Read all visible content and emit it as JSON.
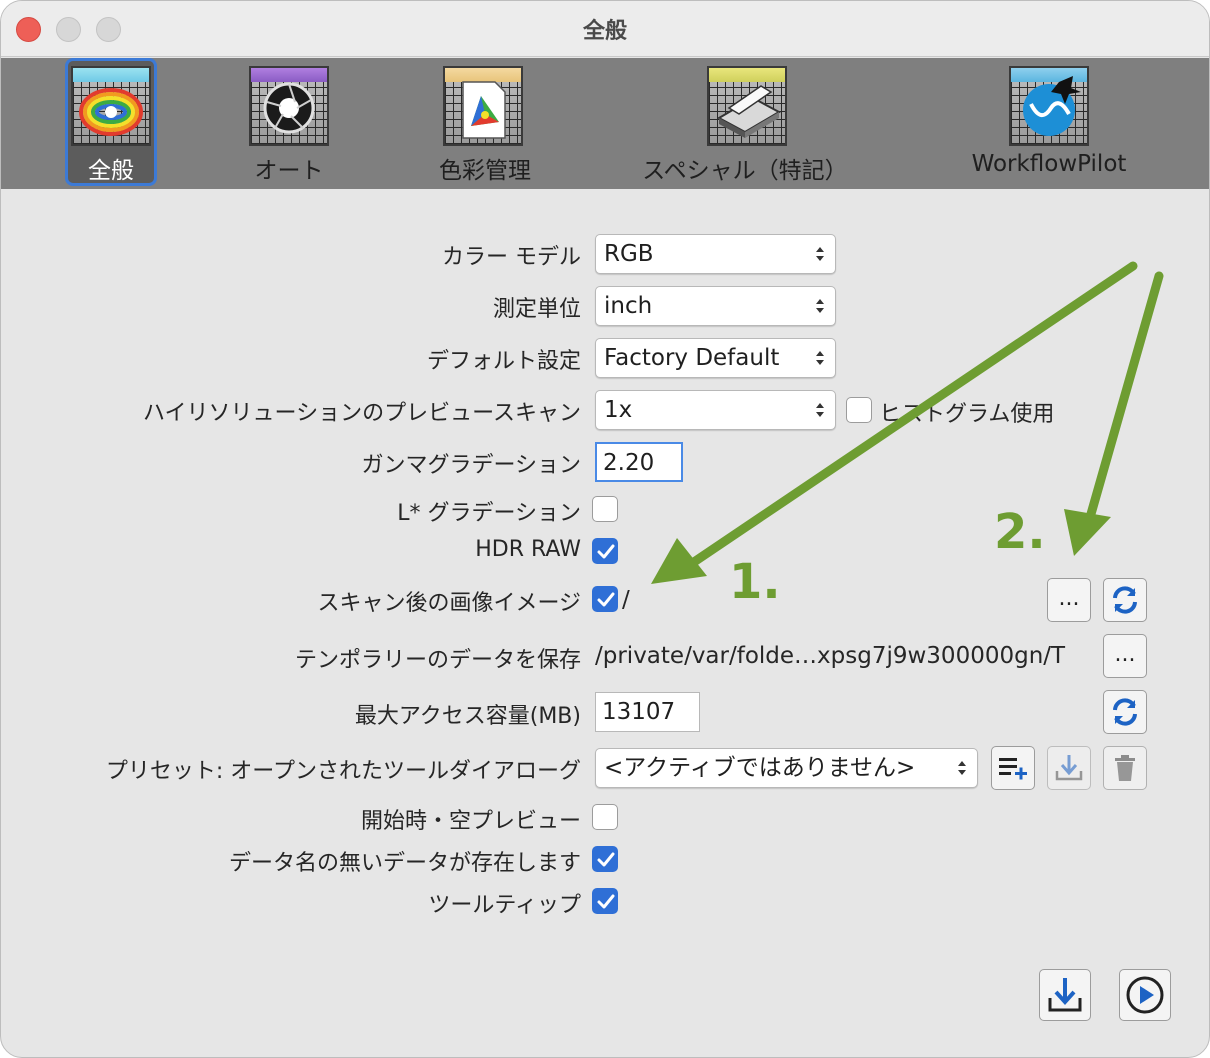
{
  "window": {
    "title": "全般"
  },
  "toolbar": {
    "items": [
      {
        "label": "全般",
        "icon": "rainbow-logo-icon",
        "selected": true
      },
      {
        "label": "オート",
        "icon": "aperture-icon",
        "selected": false
      },
      {
        "label": "色彩管理",
        "icon": "color-gamut-icon",
        "selected": false
      },
      {
        "label": "スペシャル（特記）",
        "icon": "scanner-icon",
        "selected": false
      },
      {
        "label": "WorkflowPilot",
        "icon": "workflowpilot-globe-icon",
        "selected": false
      }
    ]
  },
  "form": {
    "color_model": {
      "label": "カラー モデル",
      "value": "RGB"
    },
    "unit": {
      "label": "測定単位",
      "value": "inch"
    },
    "default_setting": {
      "label": "デフォルト設定",
      "value": "Factory Default"
    },
    "hires_preview": {
      "label": "ハイリソリューションのプレビュースキャン",
      "value": "1x"
    },
    "histogram": {
      "label": "ヒストグラム使用",
      "checked": false
    },
    "gamma": {
      "label": "ガンマグラデーション",
      "value": "2.20"
    },
    "lstar": {
      "label": "L* グラデーション",
      "checked": false
    },
    "hdr_raw": {
      "label": "HDR RAW",
      "checked": true
    },
    "after_scan": {
      "label": "スキャン後の画像イメージ",
      "checked": true,
      "path": "/",
      "browse": "...",
      "reset_icon": "refresh-icon"
    },
    "temp_data": {
      "label": "テンポラリーのデータを保存",
      "path": "/private/var/folde…xpsg7j9w300000gn/T",
      "browse": "..."
    },
    "max_access": {
      "label": "最大アクセス容量(MB)",
      "value": "13107",
      "reset_icon": "refresh-icon"
    },
    "preset": {
      "label": "プリセット: オープンされたツールダイアローグ",
      "value": "<アクティブではありません>",
      "icons": [
        "add-list-icon",
        "download-icon",
        "trash-icon"
      ]
    },
    "empty_preview": {
      "label": "開始時・空プレビュー",
      "checked": false
    },
    "unnamed_data": {
      "label": "データ名の無いデータが存在します",
      "checked": true
    },
    "tooltips": {
      "label": "ツールティップ",
      "checked": true
    }
  },
  "footer": {
    "icons": [
      "save-download-icon",
      "play-icon"
    ]
  },
  "annotations": {
    "one": "1.",
    "two": "2.",
    "color": "#6e9d32"
  },
  "colors": {
    "accent": "#2f6fd6",
    "toolbar_bg": "#7f7f7f",
    "window_bg": "#e6e6e6"
  }
}
